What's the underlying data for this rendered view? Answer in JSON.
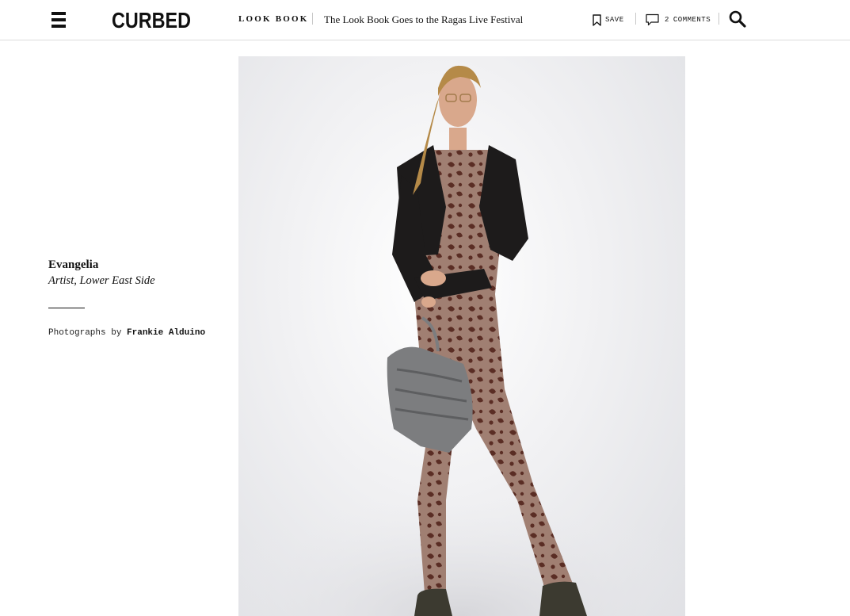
{
  "header": {
    "logo_text": "CURBED",
    "section": "LOOK BOOK",
    "article_title": "The Look Book Goes to the Ragas Live Festival",
    "save_label": "SAVE",
    "comments_count": "2",
    "comments_label": "COMMENTS"
  },
  "caption": {
    "name": "Evangelia",
    "role": "Artist, Lower East Side",
    "credit_prefix": "Photographs by",
    "credit_name": "Frankie Alduino"
  },
  "photo": {
    "alt": "Evangelia"
  },
  "icons": {
    "menu": "hamburger-icon",
    "save": "bookmark-icon",
    "comments": "comment-bubble-icon",
    "search": "magnifier-icon"
  },
  "colors": {
    "text": "#111111",
    "divider": "#dcdcdc",
    "photo_background": "#ececef"
  }
}
